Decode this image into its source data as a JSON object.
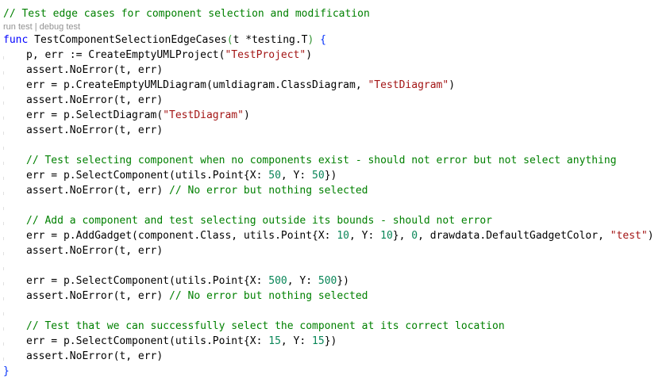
{
  "code_lens": {
    "run": "run test",
    "sep": " | ",
    "debug": "debug test"
  },
  "lines": [
    {
      "indent": 0,
      "tokens": [
        {
          "t": "// Test edge cases for component selection and modification",
          "c": "comment"
        }
      ]
    },
    {
      "lens": true
    },
    {
      "indent": 0,
      "tokens": [
        {
          "t": "func",
          "c": "kw"
        },
        {
          "t": " TestComponentSelectionEdgeCases",
          "c": ""
        },
        {
          "t": "(",
          "c": "paren"
        },
        {
          "t": "t *testing.T",
          "c": ""
        },
        {
          "t": ")",
          "c": "paren"
        },
        {
          "t": " ",
          "c": ""
        },
        {
          "t": "{",
          "c": "brace"
        }
      ]
    },
    {
      "indent": 1,
      "tokens": [
        {
          "t": "p, err := CreateEmptyUMLProject(",
          "c": ""
        },
        {
          "t": "\"TestProject\"",
          "c": "str"
        },
        {
          "t": ")",
          "c": ""
        }
      ]
    },
    {
      "indent": 1,
      "tokens": [
        {
          "t": "assert.NoError(t, err)",
          "c": ""
        }
      ]
    },
    {
      "indent": 1,
      "tokens": [
        {
          "t": "err = p.CreateEmptyUMLDiagram(umldiagram.ClassDiagram, ",
          "c": ""
        },
        {
          "t": "\"TestDiagram\"",
          "c": "str"
        },
        {
          "t": ")",
          "c": ""
        }
      ]
    },
    {
      "indent": 1,
      "tokens": [
        {
          "t": "assert.NoError(t, err)",
          "c": ""
        }
      ]
    },
    {
      "indent": 1,
      "tokens": [
        {
          "t": "err = p.SelectDiagram(",
          "c": ""
        },
        {
          "t": "\"TestDiagram\"",
          "c": "str"
        },
        {
          "t": ")",
          "c": ""
        }
      ]
    },
    {
      "indent": 1,
      "tokens": [
        {
          "t": "assert.NoError(t, err)",
          "c": ""
        }
      ]
    },
    {
      "indent": 1,
      "tokens": []
    },
    {
      "indent": 1,
      "tokens": [
        {
          "t": "// Test selecting component when no components exist - should not error but not select anything",
          "c": "comment"
        }
      ]
    },
    {
      "indent": 1,
      "tokens": [
        {
          "t": "err = p.SelectComponent(utils.Point{X: ",
          "c": ""
        },
        {
          "t": "50",
          "c": "num"
        },
        {
          "t": ", Y: ",
          "c": ""
        },
        {
          "t": "50",
          "c": "num"
        },
        {
          "t": "})",
          "c": ""
        }
      ]
    },
    {
      "indent": 1,
      "tokens": [
        {
          "t": "assert.NoError(t, err) ",
          "c": ""
        },
        {
          "t": "// No error but nothing selected",
          "c": "comment"
        }
      ]
    },
    {
      "indent": 1,
      "tokens": []
    },
    {
      "indent": 1,
      "tokens": [
        {
          "t": "// Add a component and test selecting outside its bounds - should not error",
          "c": "comment"
        }
      ]
    },
    {
      "indent": 1,
      "tokens": [
        {
          "t": "err = p.AddGadget(component.Class, utils.Point{X: ",
          "c": ""
        },
        {
          "t": "10",
          "c": "num"
        },
        {
          "t": ", Y: ",
          "c": ""
        },
        {
          "t": "10",
          "c": "num"
        },
        {
          "t": "}, ",
          "c": ""
        },
        {
          "t": "0",
          "c": "num"
        },
        {
          "t": ", drawdata.DefaultGadgetColor, ",
          "c": ""
        },
        {
          "t": "\"test\"",
          "c": "str"
        },
        {
          "t": ")",
          "c": ""
        }
      ]
    },
    {
      "indent": 1,
      "tokens": [
        {
          "t": "assert.NoError(t, err)",
          "c": ""
        }
      ]
    },
    {
      "indent": 1,
      "tokens": []
    },
    {
      "indent": 1,
      "tokens": [
        {
          "t": "err = p.SelectComponent(utils.Point{X: ",
          "c": ""
        },
        {
          "t": "500",
          "c": "num"
        },
        {
          "t": ", Y: ",
          "c": ""
        },
        {
          "t": "500",
          "c": "num"
        },
        {
          "t": "})",
          "c": ""
        }
      ]
    },
    {
      "indent": 1,
      "tokens": [
        {
          "t": "assert.NoError(t, err) ",
          "c": ""
        },
        {
          "t": "// No error but nothing selected",
          "c": "comment"
        }
      ]
    },
    {
      "indent": 1,
      "tokens": []
    },
    {
      "indent": 1,
      "tokens": [
        {
          "t": "// Test that we can successfully select the component at its correct location",
          "c": "comment"
        }
      ]
    },
    {
      "indent": 1,
      "tokens": [
        {
          "t": "err = p.SelectComponent(utils.Point{X: ",
          "c": ""
        },
        {
          "t": "15",
          "c": "num"
        },
        {
          "t": ", Y: ",
          "c": ""
        },
        {
          "t": "15",
          "c": "num"
        },
        {
          "t": "})",
          "c": ""
        }
      ]
    },
    {
      "indent": 1,
      "tokens": [
        {
          "t": "assert.NoError(t, err)",
          "c": ""
        }
      ]
    },
    {
      "indent": 0,
      "tokens": [
        {
          "t": "}",
          "c": "brace"
        }
      ]
    }
  ],
  "colors": {
    "comment": "#008000",
    "keyword": "#0000ff",
    "string": "#a31515",
    "number": "#098658",
    "text": "#000000",
    "code_lens": "#919191"
  }
}
